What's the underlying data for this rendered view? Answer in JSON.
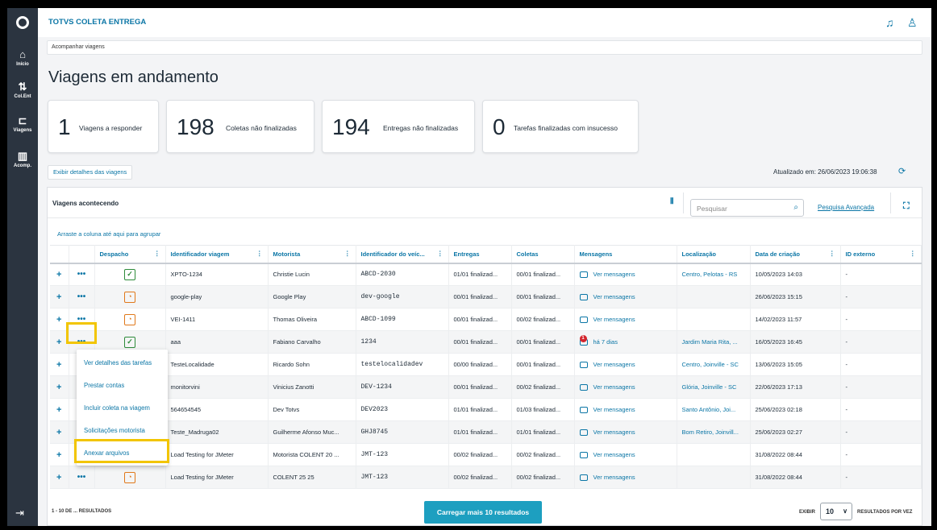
{
  "app": {
    "title": "TOTVS COLETA ENTREGA"
  },
  "rail": {
    "items": [
      {
        "label": "Início",
        "icon": "home-icon"
      },
      {
        "label": "Col.Ent",
        "icon": "route-icon"
      },
      {
        "label": "Viagens",
        "icon": "truck-icon"
      },
      {
        "label": "Acomp.",
        "icon": "map-icon"
      }
    ]
  },
  "breadcrumb": "Acompanhar viagens",
  "page_title": "Viagens em andamento",
  "cards": [
    {
      "value": "1",
      "label": "Viagens a responder"
    },
    {
      "value": "198",
      "label": "Coletas não finalizadas"
    },
    {
      "value": "194",
      "label": "Entregas não finalizadas"
    },
    {
      "value": "0",
      "label": "Tarefas finalizadas com insucesso"
    }
  ],
  "details_button": "Exibir detalhes das viagens",
  "updated_text": "Atualizado em: 26/06/2023 19:06:38",
  "panel": {
    "title": "Viagens acontecendo",
    "search_placeholder": "Pesquisar",
    "advanced_search": "Pesquisa Avançada",
    "group_hint": "Arraste a coluna até aqui para agrupar"
  },
  "columns": [
    "Despacho",
    "Identificador viagem",
    "Motorista",
    "Identificador do veíc...",
    "Entregas",
    "Coletas",
    "Mensagens",
    "Localização",
    "Data de criação",
    "ID externo"
  ],
  "rows": [
    {
      "status": "ok",
      "id": "XPTO-1234",
      "driver": "Christie Lucin",
      "vehicle": "ABCD-2030",
      "deliveries": "01/01 finalizad...",
      "pickups": "00/01 finalizad...",
      "messages": "Ver mensagens",
      "location": "Centro, Pelotas - RS",
      "created": "10/05/2023 14:03",
      "external": "-"
    },
    {
      "status": "warn",
      "id": "google-play",
      "driver": "Google Play",
      "vehicle": "dev-google",
      "deliveries": "00/01 finalizad...",
      "pickups": "00/01 finalizad...",
      "messages": "Ver mensagens",
      "location": "",
      "created": "26/06/2023 15:15",
      "external": "-"
    },
    {
      "status": "warn",
      "id": "VEI-1411",
      "driver": "Thomas Oliveira",
      "vehicle": "ABCD-1099",
      "deliveries": "00/01 finalizad...",
      "pickups": "00/02 finalizad...",
      "messages": "Ver mensagens",
      "location": "",
      "created": "14/02/2023 11:57",
      "external": "-"
    },
    {
      "status": "ok",
      "id": "aaa",
      "driver": "Fabiano Carvalho",
      "vehicle": "1234",
      "deliveries": "00/01 finalizad...",
      "pickups": "00/01 finalizad...",
      "messages": "há 7 dias",
      "message_badge": "1",
      "location": "Jardim Maria Rita, ...",
      "created": "16/05/2023 16:45",
      "external": "-"
    },
    {
      "status": "",
      "id": "TesteLocalidade",
      "driver": "Ricardo Sohn",
      "vehicle": "testelocalidadev",
      "deliveries": "00/00 finalizad...",
      "pickups": "00/01 finalizad...",
      "messages": "Ver mensagens",
      "location": "Centro, Joinville - SC",
      "created": "13/06/2023 15:05",
      "external": "-"
    },
    {
      "status": "",
      "id": "monitorvini",
      "driver": "Vinicius Zanotti",
      "vehicle": "DEV-1234",
      "deliveries": "00/01 finalizad...",
      "pickups": "00/02 finalizad...",
      "messages": "Ver mensagens",
      "location": "Glória, Joinville - SC",
      "created": "22/06/2023 17:13",
      "external": "-"
    },
    {
      "status": "",
      "id": "564654545",
      "driver": "Dev Totvs",
      "vehicle": "DEV2023",
      "deliveries": "01/01 finalizad...",
      "pickups": "01/03 finalizad...",
      "messages": "Ver mensagens",
      "location": "Santo Antônio, Joi...",
      "created": "25/06/2023 02:18",
      "external": "-"
    },
    {
      "status": "",
      "id": "Teste_Madruga02",
      "driver": "Guilherme Afonso Muc...",
      "vehicle": "GHJ8745",
      "deliveries": "01/01 finalizad...",
      "pickups": "01/01 finalizad...",
      "messages": "Ver mensagens",
      "location": "Bom Retiro, Joinvill...",
      "created": "25/06/2023 02:27",
      "external": "-"
    },
    {
      "status": "",
      "id": "Load Testing for JMeter",
      "driver": "Motorista COLENT 20 ...",
      "vehicle": "JMT-123",
      "deliveries": "00/02 finalizad...",
      "pickups": "00/02 finalizad...",
      "messages": "Ver mensagens",
      "location": "",
      "created": "31/08/2022 08:44",
      "external": "-"
    },
    {
      "status": "warn",
      "id": "Load Testing for JMeter",
      "driver": "COLENT 25 25",
      "vehicle": "JMT-123",
      "deliveries": "00/02 finalizad...",
      "pickups": "00/02 finalizad...",
      "messages": "Ver mensagens",
      "location": "",
      "created": "31/08/2022 08:44",
      "external": "-"
    }
  ],
  "row_menu": [
    "Ver detalhes das tarefas",
    "Prestar contas",
    "Incluir coleta na viagem",
    "Solicitações motorista",
    "Anexar arquivos"
  ],
  "footer": {
    "count": "1 - 10 DE ... RESULTADOS",
    "load_more": "Carregar mais 10 resultados",
    "show_label": "EXIBIR",
    "page_size": "10",
    "per_page_label": "RESULTADOS POR VEZ"
  },
  "colors": {
    "accent": "#0b76a6",
    "rail": "#2b3440",
    "highlight": "#f2c500",
    "button": "#1d9fc0"
  }
}
